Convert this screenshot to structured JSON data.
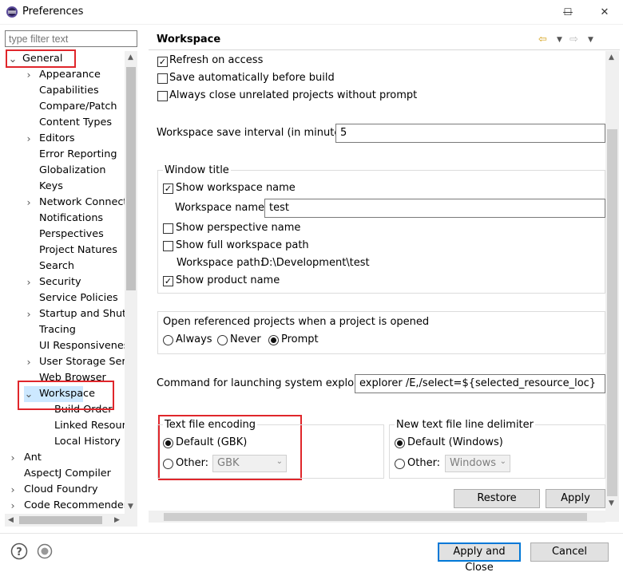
{
  "window": {
    "title": "Preferences",
    "minimize_glyph": "—",
    "maximize_glyph": "☐",
    "close_glyph": "✕"
  },
  "filter": {
    "placeholder": "type filter text"
  },
  "tree": {
    "items": [
      {
        "label": "General",
        "top": 0
      },
      {
        "label": "Appearance"
      },
      {
        "label": "Capabilities"
      },
      {
        "label": "Compare/Patch"
      },
      {
        "label": "Content Types"
      },
      {
        "label": "Editors"
      },
      {
        "label": "Error Reporting"
      },
      {
        "label": "Globalization"
      },
      {
        "label": "Keys"
      },
      {
        "label": "Network Connecti"
      },
      {
        "label": "Notifications"
      },
      {
        "label": "Perspectives"
      },
      {
        "label": "Project Natures"
      },
      {
        "label": "Search"
      },
      {
        "label": "Security"
      },
      {
        "label": "Service Policies"
      },
      {
        "label": "Startup and Shutd"
      },
      {
        "label": "Tracing"
      },
      {
        "label": "UI Responsiveness"
      },
      {
        "label": "User Storage Serv"
      },
      {
        "label": "Web Browser"
      },
      {
        "label": "Workspace"
      },
      {
        "label": "Build Order"
      },
      {
        "label": "Linked Resourc"
      },
      {
        "label": "Local History"
      },
      {
        "label": "Ant"
      },
      {
        "label": "AspectJ Compiler"
      },
      {
        "label": "Cloud Foundry"
      },
      {
        "label": "Code Recommenders"
      }
    ]
  },
  "page": {
    "title": "Workspace",
    "refresh_on_access": "Refresh on access",
    "save_automatically": "Save automatically before build",
    "always_close": "Always close unrelated projects without prompt",
    "save_interval_label": "Workspace save interval (in minutes):",
    "save_interval_value": "5",
    "window_title_group": "Window title",
    "show_workspace_name": "Show workspace name",
    "workspace_name_label": "Workspace name:",
    "workspace_name_value": "test",
    "show_perspective_name": "Show perspective name",
    "show_full_path": "Show full workspace path",
    "workspace_path_label": "Workspace path:",
    "workspace_path_value": "D:\\Development\\test",
    "show_product_name": "Show product name",
    "open_referenced_group": "Open referenced projects when a project is opened",
    "opt_always": "Always",
    "opt_never": "Never",
    "opt_prompt": "Prompt",
    "command_label": "Command for launching system explorer:",
    "command_value": "explorer /E,/select=${selected_resource_loc}",
    "encoding_group": "Text file encoding",
    "encoding_default": "Default (GBK)",
    "encoding_other": "Other:",
    "encoding_combo": "GBK",
    "delimiter_group": "New text file line delimiter",
    "delimiter_default": "Default (Windows)",
    "delimiter_other": "Other:",
    "delimiter_combo": "Windows",
    "restore_defaults": "Restore Defaults",
    "apply": "Apply"
  },
  "footer": {
    "apply_and_close": "Apply and Close",
    "cancel": "Cancel"
  },
  "colors": {
    "annotation_red": "#e0262b",
    "accent_blue": "#0078d7"
  }
}
